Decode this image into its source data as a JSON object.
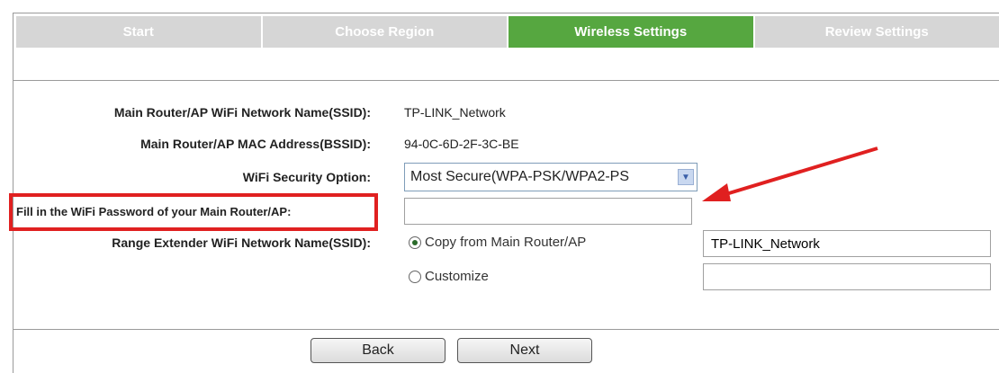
{
  "tabs": [
    {
      "label": "Start",
      "active": false
    },
    {
      "label": "Choose Region",
      "active": false
    },
    {
      "label": "Wireless Settings",
      "active": true
    },
    {
      "label": "Review Settings",
      "active": false
    }
  ],
  "form": {
    "ssid_label": "Main Router/AP WiFi Network Name(SSID):",
    "ssid_value": "TP-LINK_Network",
    "mac_label": "Main Router/AP MAC Address(BSSID):",
    "mac_value": "94-0C-6D-2F-3C-BE",
    "security_label": "WiFi Security Option:",
    "security_value": "Most Secure(WPA-PSK/WPA2-PS",
    "password_label": "Fill in the WiFi Password of your Main Router/AP:",
    "password_value": "",
    "extender_label": "Range Extender WiFi Network Name(SSID):",
    "copy_option": "Copy from Main Router/AP",
    "copy_value": "TP-LINK_Network",
    "customize_option": "Customize",
    "customize_value": ""
  },
  "buttons": {
    "back": "Back",
    "next": "Next"
  },
  "colors": {
    "active_tab": "#56a740",
    "inactive_tab": "#d6d6d6",
    "highlight": "#e02020"
  }
}
